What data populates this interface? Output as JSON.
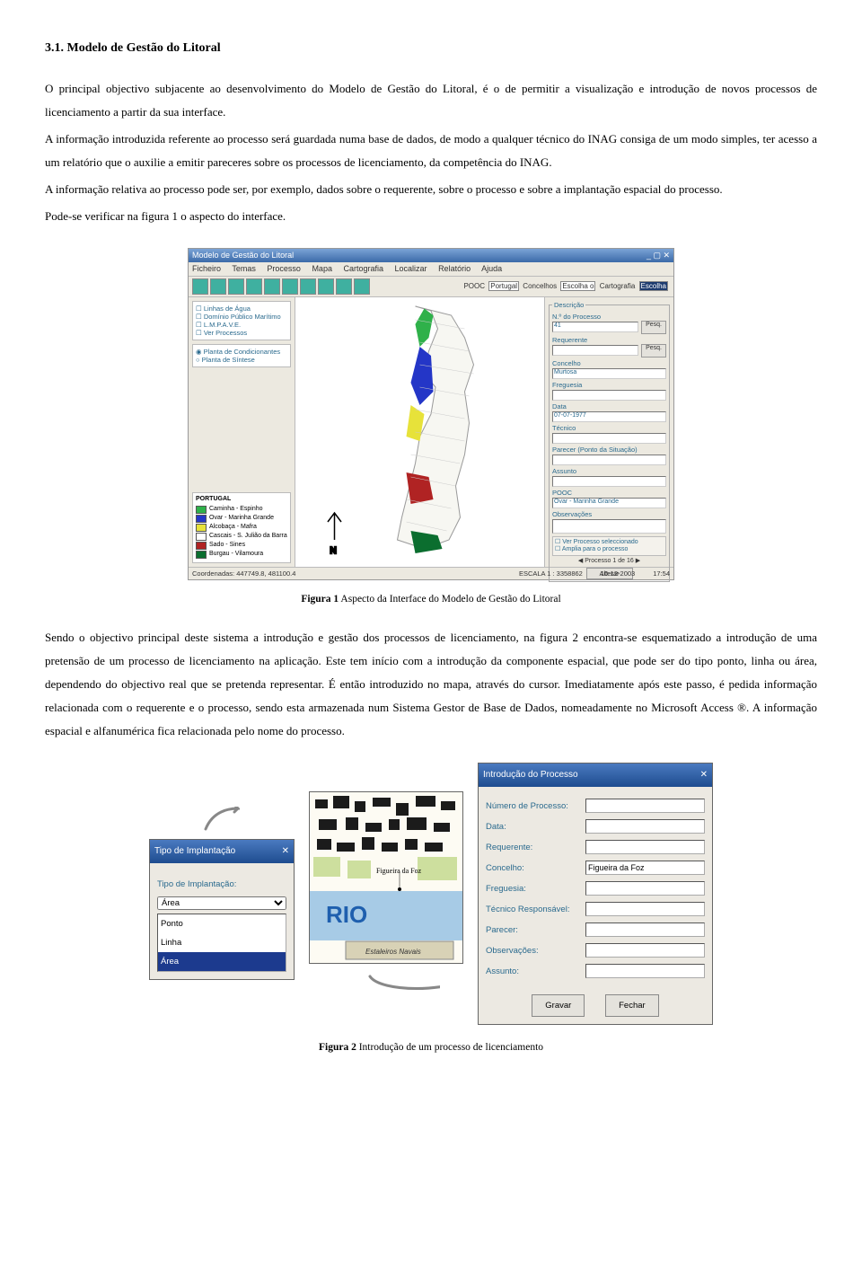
{
  "section_title": "3.1. Modelo de Gestão do Litoral",
  "para1": "O principal objectivo subjacente ao desenvolvimento do Modelo de Gestão do Litoral, é o de permitir a visualização e introdução de novos processos de licenciamento a partir da sua interface.",
  "para2": "A informação introduzida referente ao processo será guardada numa base de dados, de modo a qualquer técnico do INAG consiga de um modo simples, ter acesso a um relatório que o auxilie a emitir pareceres sobre os processos de licenciamento, da competência do INAG.",
  "para3": "A informação relativa ao processo pode ser, por exemplo, dados sobre o requerente, sobre o processo e sobre a implantação espacial do processo.",
  "para4": "Pode-se verificar na figura 1 o aspecto do interface.",
  "fig1": {
    "caption_label": "Figura 1",
    "caption_text": " Aspecto da Interface do Modelo de Gestão do Litoral",
    "app_title": "Modelo de Gestão do Litoral",
    "menu": [
      "Ficheiro",
      "Temas",
      "Processo",
      "Mapa",
      "Cartografia",
      "Localizar",
      "Relatório",
      "Ajuda"
    ],
    "toolbar_right": {
      "pooc_label": "POOC",
      "pooc_value": "Portugal",
      "concelhos_label": "Concelhos",
      "concelhos_value": "Escolha o",
      "carto_label": "Cartografia",
      "carto_value": "Escolha"
    },
    "left": {
      "grp1": [
        "Linhas de Água",
        "Domínio Público Marítimo",
        "L.M.P.A.V.E.",
        "Ver Processos"
      ],
      "grp2": [
        "Planta de Condicionantes",
        "Planta de Síntese"
      ],
      "legend_title": "PORTUGAL",
      "legend": [
        {
          "color": "#2fb14a",
          "label": "Caminha - Espinho"
        },
        {
          "color": "#2436c7",
          "label": "Ovar - Marinha Grande"
        },
        {
          "color": "#e7e23a",
          "label": "Alcobaça - Mafra"
        },
        {
          "color": "#ffffff",
          "label": "Cascais - S. Julião da Barra"
        },
        {
          "color": "#b02323",
          "label": "Sado - Sines"
        },
        {
          "color": "#0b6e2f",
          "label": "Burgau - Vilamoura"
        }
      ]
    },
    "right": {
      "panel_title": "Descrição",
      "lbl_numprocesso": "N.º do Processo",
      "val_numprocesso": "41",
      "btn_pesq": "Pesq.",
      "lbl_requerente": "Requerente",
      "lbl_concelho": "Concelho",
      "val_concelho": "Murtosa",
      "lbl_freguesia": "Freguesia",
      "lbl_data": "Data",
      "val_data": "07-07-1977",
      "lbl_tecnico": "Técnico",
      "lbl_parecer": "Parecer (Ponto da Situação)",
      "lbl_assunto": "Assunto",
      "lbl_pooc": "POOC",
      "val_pooc": "Ovar - Marinha Grande",
      "lbl_obs": "Observações",
      "chk1": "Ver Processo seleccionado",
      "chk2": "Amplia para o processo",
      "counter": "Processo 1 de 16",
      "btn_alterar": "Alterar"
    },
    "status": {
      "coords": "Coordenadas: 447749.8, 481100.4",
      "scale": "ESCALA    1 : 3358862",
      "date": "10-12-2003",
      "time": "17:54"
    }
  },
  "para5": "Sendo o objectivo principal deste sistema a introdução e gestão dos processos de licenciamento, na figura 2 encontra-se esquematizado a introdução de uma pretensão de um processo de licenciamento na aplicação. Este tem início com a introdução da componente espacial, que pode ser do tipo ponto, linha ou área, dependendo do objectivo real que se pretenda representar. É então introduzido no mapa, através do cursor. Imediatamente após este passo, é pedida informação relacionada com o requerente e o processo, sendo esta armazenada num Sistema Gestor de Base de Dados, nomeadamente no Microsoft Access ®. A informação espacial e alfanumérica fica relacionada pelo nome do processo.",
  "fig2": {
    "caption_label": "Figura 2",
    "caption_text": " Introdução de um processo de licenciamento",
    "dlg1": {
      "title": "Tipo de Implantação",
      "label": "Tipo de Implantação:",
      "selected": "Área",
      "options": [
        "Ponto",
        "Linha",
        "Área"
      ]
    },
    "map": {
      "town": "Figueira da Foz",
      "rio": "RIO",
      "foot": "Estaleiros Navais"
    },
    "dlg2": {
      "title": "Introdução do Processo",
      "fields": [
        {
          "label": "Número de Processo:",
          "value": ""
        },
        {
          "label": "Data:",
          "value": ""
        },
        {
          "label": "Requerente:",
          "value": ""
        },
        {
          "label": "Concelho:",
          "value": "Figueira da Foz"
        },
        {
          "label": "Freguesia:",
          "value": ""
        },
        {
          "label": "Técnico Responsável:",
          "value": ""
        },
        {
          "label": "Parecer:",
          "value": ""
        },
        {
          "label": "Observações:",
          "value": ""
        },
        {
          "label": "Assunto:",
          "value": ""
        }
      ],
      "btn_save": "Gravar",
      "btn_close": "Fechar"
    }
  }
}
